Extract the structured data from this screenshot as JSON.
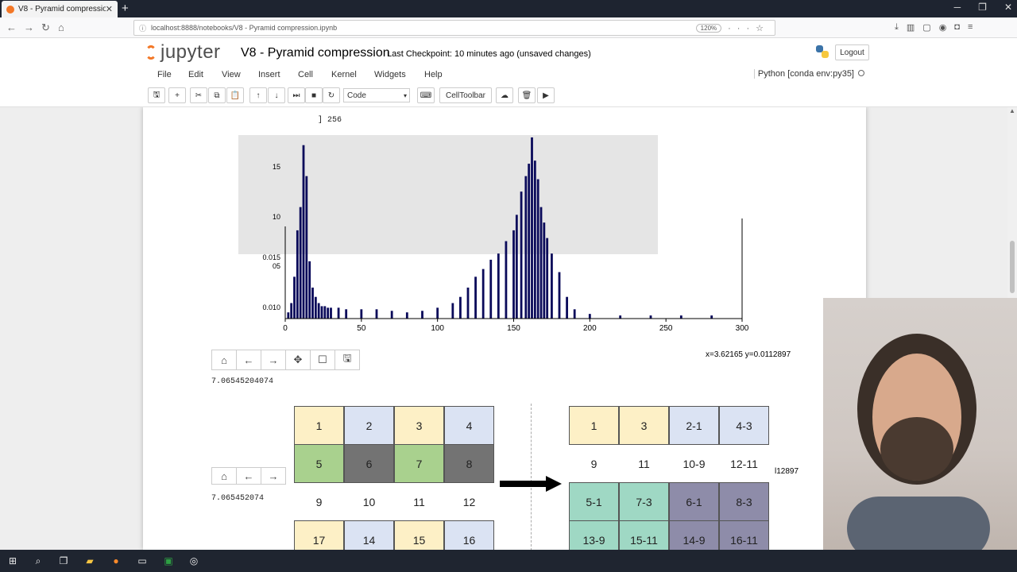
{
  "browser": {
    "tab_title": "V8 - Pyramid compression",
    "url": "localhost:8888/notebooks/V8 - Pyramid compression.ipynb",
    "zoom": "120%"
  },
  "jupyter": {
    "logo_text": "jupyter",
    "notebook_title": "V8 - Pyramid compression",
    "checkpoint": "Last Checkpoint: 10 minutes ago (unsaved changes)",
    "logout_label": "Logout",
    "menu": [
      "File",
      "Edit",
      "View",
      "Insert",
      "Cell",
      "Kernel",
      "Widgets",
      "Help"
    ],
    "kernel": "Python [conda env:py35]",
    "cell_type": "Code",
    "celltoolbar_label": "CellToolbar"
  },
  "output": {
    "overflow_text": "] 256",
    "coords": "x=3.62165 y=0.0112897",
    "coords_partial": "l12897",
    "value1": "7.06545204074",
    "value2": "7.065452074"
  },
  "chart_data": {
    "type": "bar",
    "xlim": [
      0,
      300
    ],
    "xticks": [
      "0",
      "50",
      "100",
      "150",
      "200",
      "250",
      "300"
    ],
    "yticks": [
      "0.010",
      "0.015",
      "05",
      "10",
      "15"
    ],
    "bar_color": "#0a0a5a",
    "x": [
      2,
      4,
      6,
      8,
      10,
      12,
      14,
      16,
      18,
      20,
      22,
      24,
      26,
      28,
      30,
      35,
      40,
      50,
      60,
      70,
      80,
      90,
      100,
      110,
      115,
      120,
      125,
      130,
      135,
      140,
      145,
      150,
      152,
      155,
      158,
      160,
      162,
      164,
      166,
      168,
      170,
      172,
      175,
      180,
      185,
      190,
      200,
      220,
      240,
      260,
      280
    ],
    "values": [
      0.0102,
      0.0108,
      0.0125,
      0.0155,
      0.017,
      0.021,
      0.019,
      0.0135,
      0.0118,
      0.0112,
      0.0108,
      0.0106,
      0.0106,
      0.0105,
      0.0105,
      0.0105,
      0.0104,
      0.0104,
      0.0104,
      0.0103,
      0.0102,
      0.0103,
      0.0105,
      0.0108,
      0.0112,
      0.0118,
      0.0125,
      0.013,
      0.0136,
      0.014,
      0.0148,
      0.0155,
      0.0165,
      0.018,
      0.019,
      0.0198,
      0.0215,
      0.02,
      0.0188,
      0.017,
      0.016,
      0.015,
      0.014,
      0.0128,
      0.0112,
      0.0104,
      0.0101,
      0.01,
      0.01,
      0.01,
      0.01
    ]
  },
  "diagram": {
    "left_grid": [
      [
        "1",
        "2",
        "3",
        "4"
      ],
      [
        "5",
        "6",
        "7",
        "8"
      ],
      [
        "9",
        "10",
        "11",
        "12"
      ],
      [
        "17",
        "14",
        "15",
        "16"
      ]
    ],
    "right_grid": [
      [
        "1",
        "3",
        "2-1",
        "4-3"
      ],
      [
        "9",
        "11",
        "10-9",
        "12-11"
      ],
      [
        "5-1",
        "7-3",
        "6-1",
        "8-3"
      ],
      [
        "13-9",
        "15-11",
        "14-9",
        "16-11"
      ]
    ]
  }
}
